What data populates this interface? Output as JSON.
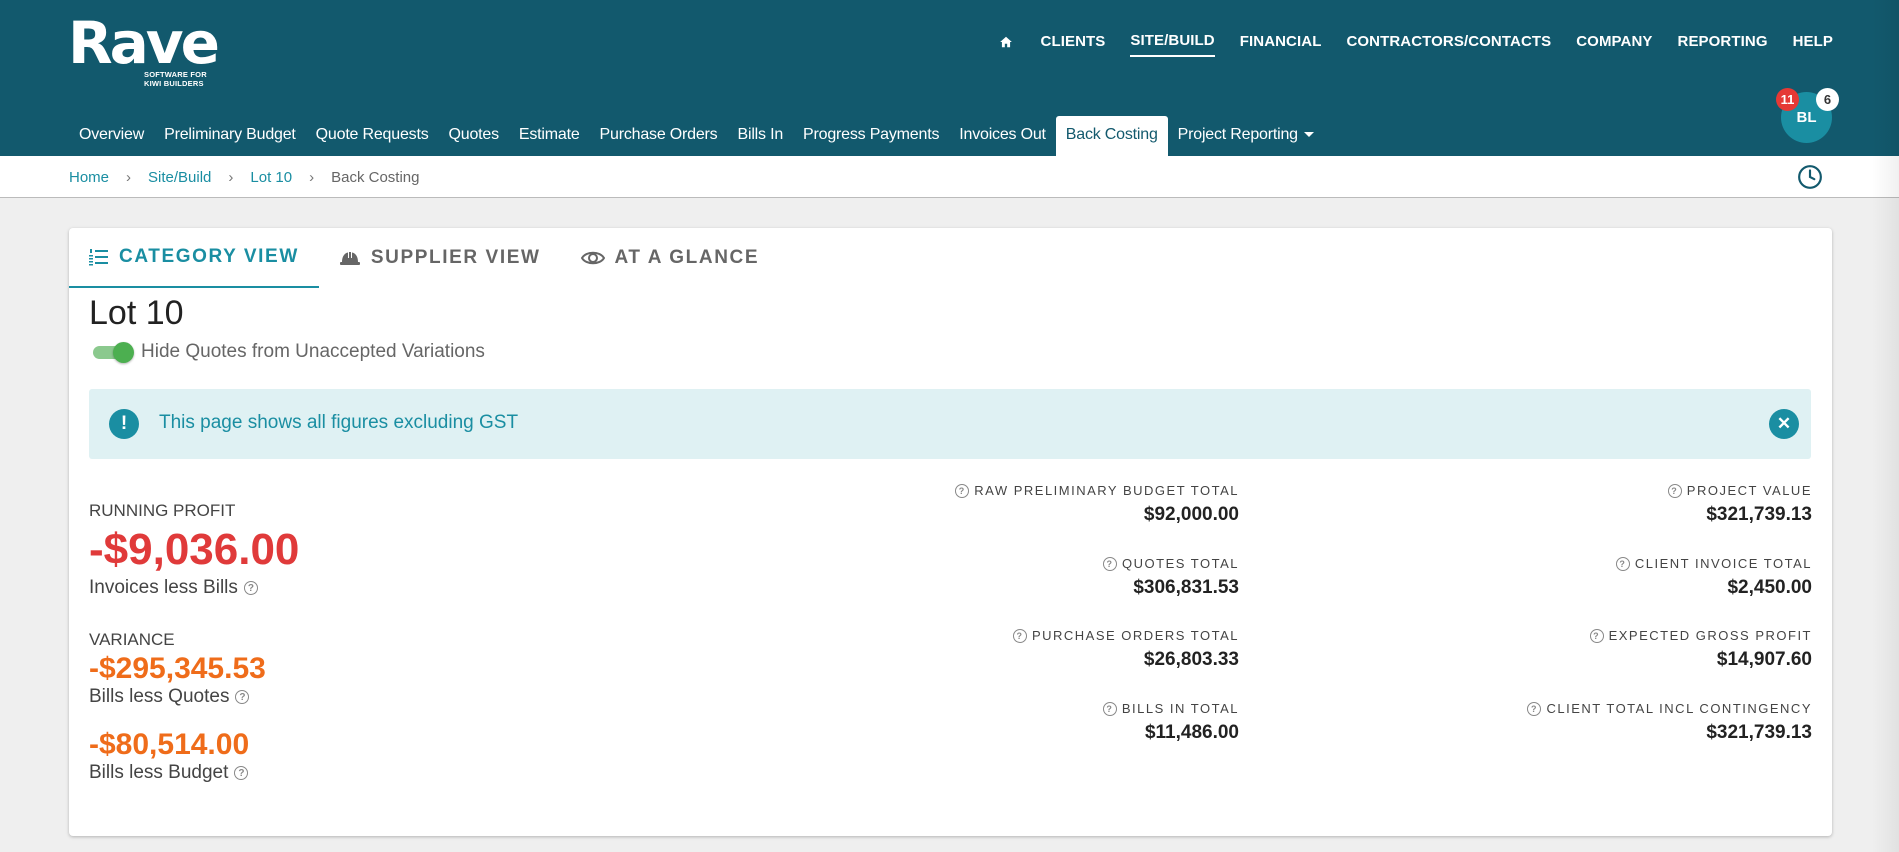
{
  "logo": {
    "word": "Rave",
    "tagline": "SOFTWARE FOR KIWI BUILDERS"
  },
  "topnav": {
    "home_icon": "home-icon",
    "items": [
      "CLIENTS",
      "SITE/BUILD",
      "FINANCIAL",
      "CONTRACTORS/CONTACTS",
      "COMPANY",
      "REPORTING",
      "HELP"
    ],
    "active": "SITE/BUILD"
  },
  "subnav": {
    "items": [
      "Overview",
      "Preliminary Budget",
      "Quote Requests",
      "Quotes",
      "Estimate",
      "Purchase Orders",
      "Bills In",
      "Progress Payments",
      "Invoices Out",
      "Back Costing",
      "Project Reporting"
    ],
    "active": "Back Costing"
  },
  "user": {
    "initials": "BL",
    "badge_red": "11",
    "badge_white": "6"
  },
  "breadcrumb": {
    "home": "Home",
    "section": "Site/Build",
    "lot": "Lot 10",
    "current": "Back Costing"
  },
  "tabs": {
    "category": "CATEGORY VIEW",
    "supplier": "SUPPLIER VIEW",
    "glance": "AT A GLANCE"
  },
  "lot_title": "Lot 10",
  "toggle": {
    "label": "Hide Quotes from Unaccepted Variations",
    "on": true
  },
  "alert": {
    "icon": "!",
    "text": "This page shows all figures excluding GST"
  },
  "running_profit": {
    "label": "RUNNING PROFIT",
    "value": "-$9,036.00",
    "sub": "Invoices less Bills"
  },
  "variance": {
    "label": "VARIANCE",
    "quotes_value": "-$295,345.53",
    "quotes_sub": "Bills less Quotes",
    "budget_value": "-$80,514.00",
    "budget_sub": "Bills less Budget"
  },
  "metrics_left": [
    {
      "label": "RAW PRELIMINARY BUDGET TOTAL",
      "value": "$92,000.00"
    },
    {
      "label": "QUOTES TOTAL",
      "value": "$306,831.53"
    },
    {
      "label": "PURCHASE ORDERS TOTAL",
      "value": "$26,803.33"
    },
    {
      "label": "BILLS IN TOTAL",
      "value": "$11,486.00"
    }
  ],
  "metrics_right": [
    {
      "label": "PROJECT VALUE",
      "value": "$321,739.13"
    },
    {
      "label": "CLIENT INVOICE TOTAL",
      "value": "$2,450.00"
    },
    {
      "label": "EXPECTED GROSS PROFIT",
      "value": "$14,907.60"
    },
    {
      "label": "CLIENT TOTAL INCL CONTINGENCY",
      "value": "$321,739.13"
    }
  ],
  "colors": {
    "header": "#12596d",
    "accent": "#1a8ea2",
    "negative": "#e03a3a",
    "warning": "#ef6c1a",
    "toggle_on": "#4caf50"
  }
}
